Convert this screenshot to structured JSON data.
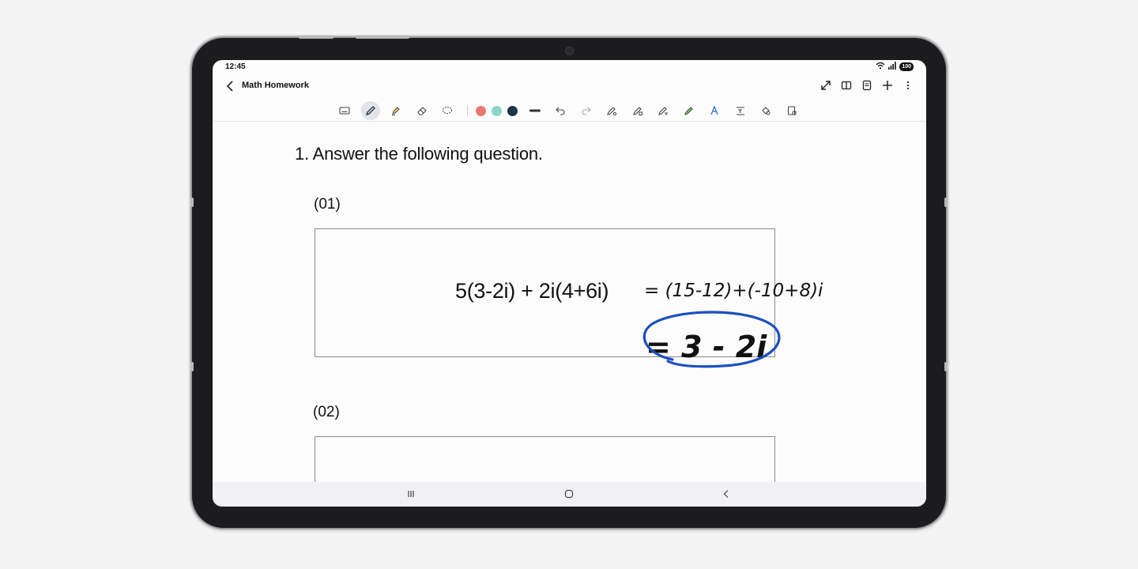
{
  "status": {
    "time": "12:45",
    "battery": "100"
  },
  "app": {
    "title": "Math Homework"
  },
  "toolbar": {
    "tools": [
      "keyboard-icon",
      "pen-icon",
      "highlighter-icon",
      "eraser-icon",
      "lasso-select-icon"
    ],
    "colors": [
      "#e8796a",
      "#8fd4c9",
      "#1f3446"
    ],
    "extra_tools": [
      "stroke-width-icon",
      "undo-icon",
      "redo-icon",
      "pen-settings-icon",
      "shape-recognize-icon",
      "text-convert-icon",
      "pen-color-icon",
      "spell-icon",
      "insert-text-icon",
      "eraser-shape-icon",
      "lock-icon"
    ]
  },
  "document": {
    "heading": "1.  Answer the following question.",
    "questions": [
      {
        "label": "(01)",
        "equation": "5(3-2i) + 2i(4+6i)",
        "handwritten_step": "= (15-12)+(-10+8)i",
        "handwritten_answer": "= 3 - 2i"
      },
      {
        "label": "(02)"
      }
    ]
  },
  "colors": {
    "ink_blue": "#1c4fbf",
    "ink_black": "#111111"
  }
}
